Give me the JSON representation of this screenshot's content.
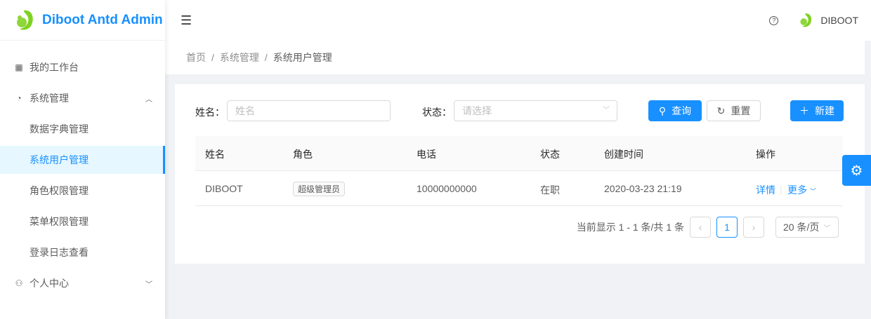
{
  "app": {
    "title": "Diboot Antd Admin",
    "user": "DIBOOT"
  },
  "sidebar": {
    "items": [
      {
        "label": "我的工作台",
        "icon": "dashboard-icon"
      },
      {
        "label": "系统管理",
        "icon": "gauge-icon"
      },
      {
        "label": "数据字典管理"
      },
      {
        "label": "系统用户管理"
      },
      {
        "label": "角色权限管理"
      },
      {
        "label": "菜单权限管理"
      },
      {
        "label": "登录日志查看"
      },
      {
        "label": "个人中心",
        "icon": "user-icon"
      }
    ]
  },
  "breadcrumb": [
    "首页",
    "系统管理",
    "系统用户管理"
  ],
  "breadcrumb_sep": "/",
  "form": {
    "name_label": "姓名",
    "name_placeholder": "姓名",
    "status_label": "状态",
    "status_placeholder": "请选择",
    "search": "查询",
    "reset": "重置",
    "create": "新建"
  },
  "table": {
    "headers": [
      "姓名",
      "角色",
      "电话",
      "状态",
      "创建时间",
      "操作"
    ],
    "rows": [
      {
        "name": "DIBOOT",
        "role": "超级管理员",
        "phone": "10000000000",
        "status": "在职",
        "created": "2020-03-23 21:19",
        "detail": "详情",
        "more": "更多"
      }
    ]
  },
  "pagination": {
    "summary": "当前显示 1 - 1 条/共 1 条",
    "current": "1",
    "page_size": "20 条/页"
  },
  "colors": {
    "primary": "#1890ff"
  }
}
